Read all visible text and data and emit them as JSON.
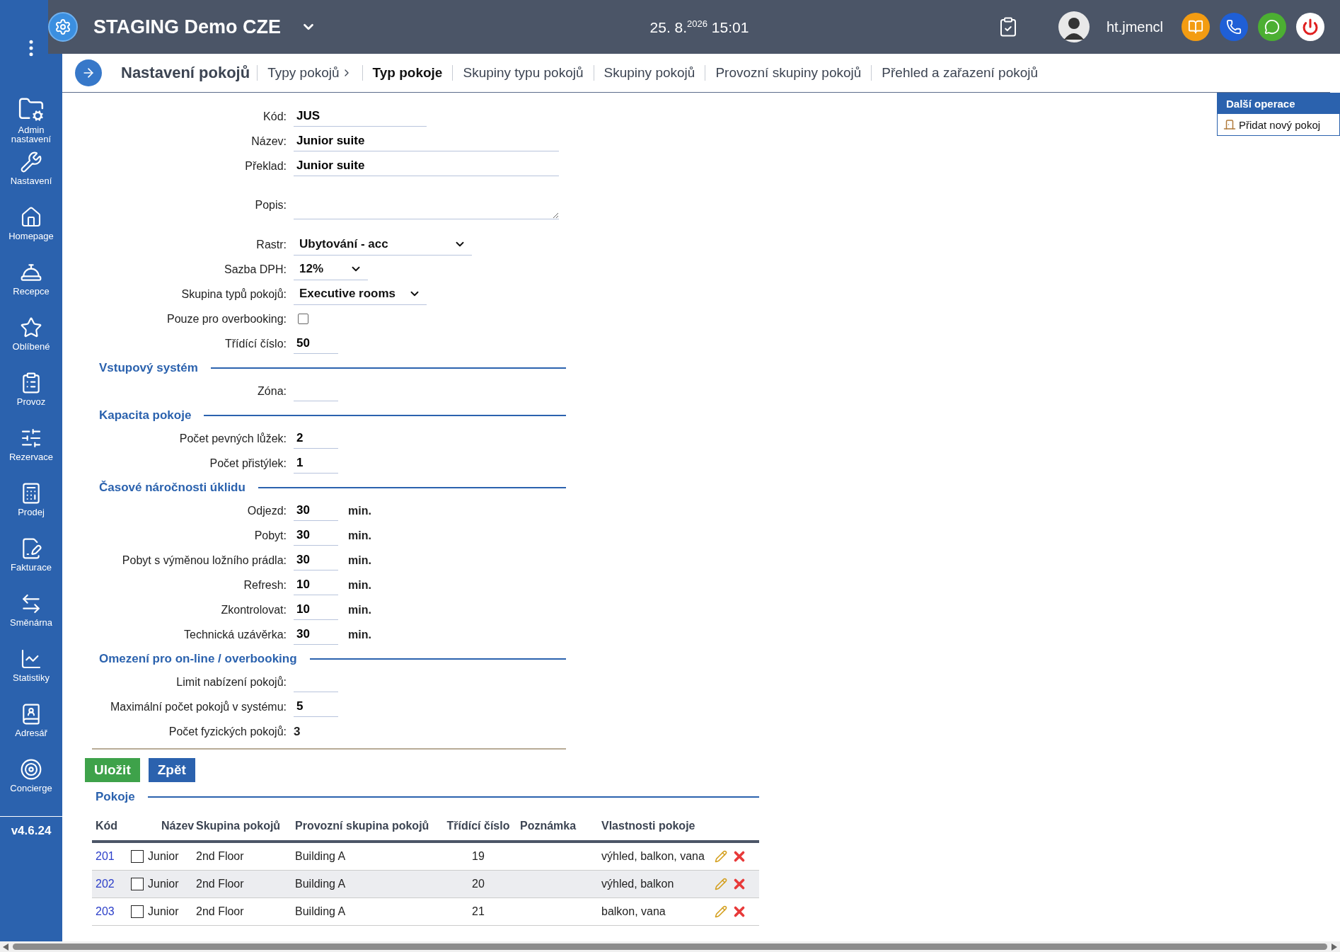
{
  "header": {
    "title": "STAGING Demo CZE",
    "datetime": "25. 8.$^{2026}$ 15:01",
    "user": "ht.jmencl"
  },
  "sidebar": {
    "items": [
      {
        "label": "Admin nastavení"
      },
      {
        "label": "Nastavení"
      },
      {
        "label": "Homepage"
      },
      {
        "label": "Recepce"
      },
      {
        "label": "Oblíbené"
      },
      {
        "label": "Provoz"
      },
      {
        "label": "Rezervace"
      },
      {
        "label": "Prodej"
      },
      {
        "label": "Fakturace"
      },
      {
        "label": "Směnárna"
      },
      {
        "label": "Statistiky"
      },
      {
        "label": "Adresář"
      },
      {
        "label": "Concierge"
      }
    ],
    "version": "v4.6.24"
  },
  "breadcrumb": {
    "title": "Nastavení pokojů",
    "tabs": [
      {
        "label": "Typy pokojů",
        "selected": false,
        "chevron": true
      },
      {
        "label": "Typ pokoje",
        "selected": true
      },
      {
        "label": "Skupiny typu pokojů",
        "selected": false
      },
      {
        "label": "Skupiny pokojů",
        "selected": false
      },
      {
        "label": "Provozní skupiny pokojů",
        "selected": false
      },
      {
        "label": "Přehled a zařazení pokojů",
        "selected": false
      }
    ]
  },
  "side_panel": {
    "title": "Další operace",
    "actions": [
      "Přidat nový pokoj"
    ]
  },
  "form": {
    "sections": [
      {
        "fields": [
          {
            "kind": "medium",
            "label": "Kód:",
            "value": "JUS"
          },
          {
            "kind": "long",
            "label": "Název:",
            "value": "Junior suite"
          },
          {
            "kind": "long",
            "label": "Překlad:",
            "value": "Junior suite"
          },
          {
            "kind": "textarea",
            "label": "Popis:"
          },
          {
            "kind": "select",
            "label": "Rastr:",
            "value": "Ubytování - acc"
          },
          {
            "kind": "select",
            "label": "Sazba DPH:",
            "value": "12%"
          },
          {
            "kind": "select",
            "label": "Skupina typů pokojů:",
            "value": "Executive rooms"
          },
          {
            "kind": "checkbox",
            "label": "Pouze pro overbooking:",
            "checked": false
          },
          {
            "kind": "short",
            "label": "Třídící číslo:",
            "value": "50"
          }
        ]
      },
      {
        "heading": "Vstupový systém",
        "fields": [
          {
            "kind": "short",
            "label": "Zóna:"
          }
        ]
      },
      {
        "heading": "Kapacita pokoje",
        "fields": [
          {
            "kind": "short",
            "label": "Počet pevných lůžek:",
            "value": "2"
          },
          {
            "kind": "short",
            "label": "Počet přistýlek:",
            "value": "1"
          }
        ]
      },
      {
        "heading": "Časové náročnosti úklidu",
        "fields": [
          {
            "kind": "short",
            "label": "Odjezd:",
            "value": "30",
            "unit": "min."
          },
          {
            "kind": "short",
            "label": "Pobyt:",
            "value": "30",
            "unit": "min."
          },
          {
            "kind": "short",
            "label": "Pobyt s výměnou ložního prádla:",
            "value": "30",
            "unit": "min."
          },
          {
            "kind": "short",
            "label": "Refresh:",
            "value": "10",
            "unit": "min."
          },
          {
            "kind": "short",
            "label": "Zkontrolovat:",
            "value": "10",
            "unit": "min."
          },
          {
            "kind": "short",
            "label": "Technická uzávěrka:",
            "value": "30",
            "unit": "min."
          }
        ]
      },
      {
        "heading": "Omezení pro on-line / overbooking",
        "fields": [
          {
            "kind": "short",
            "label": "Limit nabízení pokojů:"
          },
          {
            "kind": "short",
            "label": "Maximální počet pokojů v systému:",
            "value": "5"
          },
          {
            "kind": "static",
            "label": "Počet fyzických pokojů:",
            "value": "3"
          }
        ]
      }
    ],
    "buttons": [
      {
        "label": "Uložit",
        "kind": "primary"
      },
      {
        "label": "Zpět",
        "kind": "secondary"
      }
    ]
  },
  "rooms": {
    "title": "Pokoje",
    "columns": [
      "Kód",
      "Název",
      "Skupina pokojů",
      "Provozní skupina pokojů",
      "Třídící číslo",
      "Poznámka",
      "Vlastnosti pokoje"
    ],
    "rows": [
      {
        "code": "201",
        "checked": false,
        "name": "Junior",
        "group": "2nd Floor",
        "operational_group": "Building A",
        "sort": "19",
        "properties": "výhled, balkon, vana"
      },
      {
        "code": "202",
        "checked": false,
        "name": "Junior",
        "group": "2nd Floor",
        "operational_group": "Building A",
        "sort": "20",
        "properties": "výhled, balkon"
      },
      {
        "code": "203",
        "checked": false,
        "name": "Junior",
        "group": "2nd Floor",
        "operational_group": "Building A",
        "sort": "21",
        "properties": "balkon, vana"
      }
    ]
  }
}
